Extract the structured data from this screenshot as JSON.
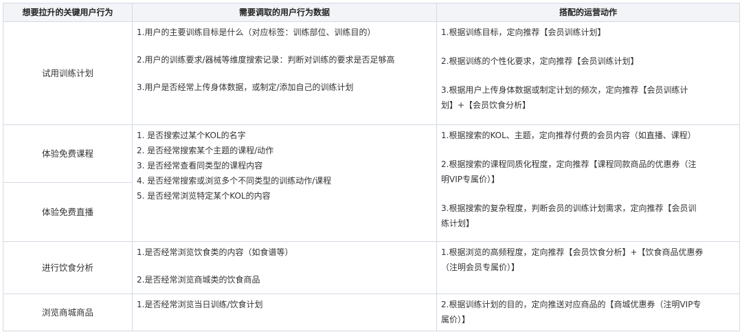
{
  "headers": [
    "想要拉升的关键用户行为",
    "需要调取的用户行为数据",
    "搭配的运营动作"
  ],
  "rows": [
    {
      "behavior": "试用训练计划",
      "data": [
        "1.用户的主要训练目标是什么（对应标签：训练部位、训练目的）",
        "2.用户的训练要求/器械等维度搜索记录：判断对训练的要求是否足够高",
        "3.用户是否经常上传身体数据，或制定/添加自己的训练计划"
      ],
      "actions": [
        "1.根据训练目标，定向推荐【会员训练计划】",
        "2.根据训练的个性化要求，定向推荐【会员训练计划】",
        "3.根据用户上传身体数据或制定计划的频次，定向推荐【会员训练计",
        "划】+【会员饮食分析】"
      ]
    },
    {
      "behavior": "体验免费课程",
      "data": [
        "1.  是否搜索过某个KOL的名字",
        "2.  是否经常搜索某个主题的课程/动作",
        "3.  是否经常查看同类型的课程内容",
        "4.  是否经常搜索或浏览多个不同类型的训练动作/课程",
        "5.  是否经常浏览特定某个KOL的内容"
      ],
      "actions": [
        "1.根据搜索的KOL、主题，定向推荐付费的会员内容（如直播、课程）",
        "2.根据搜索的课程同质化程度，定向推荐【课程同款商品的优惠券（注",
        "明VIP专属价）】",
        "3.根据搜索的复杂程度，判断会员的训练计划需求，定向推荐【会员训",
        "练计划】"
      ]
    },
    {
      "behavior": "体验免费直播"
    },
    {
      "behavior": "进行饮食分析",
      "data": [
        "1.是否经常浏览饮食类的内容（如食谱等）",
        "2.是否经常浏览商城类的饮食商品"
      ],
      "actions": [
        "1.根据浏览的高频程度，定向推荐【会员饮食分析】+【饮食商品优惠券",
        "（注明会员专属价）】"
      ]
    },
    {
      "behavior": "浏览商城商品",
      "data": [
        "1.是否经常浏览当日训练/饮食计划"
      ],
      "actions": [
        "2.根据训练计划的目的，定向推送对应商品的【商城优惠券（注明VIP专",
        "属价）】"
      ]
    }
  ]
}
